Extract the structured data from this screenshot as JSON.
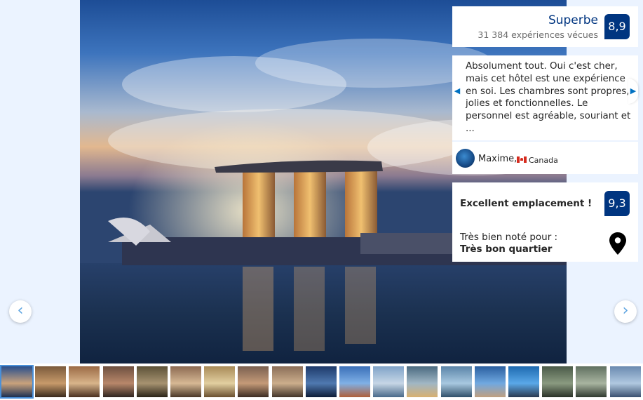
{
  "gallery": {
    "prev_label": "‹",
    "next_label": "›",
    "thumbnails": [
      {
        "name": "thumb-1",
        "colors": [
          "#2a4f8c",
          "#c9a27c",
          "#1b2f52"
        ],
        "selected": true
      },
      {
        "name": "thumb-2",
        "colors": [
          "#7a5a3c",
          "#c79a6a",
          "#3a2a1c"
        ],
        "selected": false
      },
      {
        "name": "thumb-3",
        "colors": [
          "#9b6a45",
          "#d8b48a",
          "#4a3020"
        ],
        "selected": false
      },
      {
        "name": "thumb-4",
        "colors": [
          "#6d5040",
          "#b8876a",
          "#2f2520"
        ],
        "selected": false
      },
      {
        "name": "thumb-5",
        "colors": [
          "#5c5238",
          "#a69270",
          "#2a2418"
        ],
        "selected": false
      },
      {
        "name": "thumb-6",
        "colors": [
          "#8c6a52",
          "#d6b894",
          "#4a3828"
        ],
        "selected": false
      },
      {
        "name": "thumb-7",
        "colors": [
          "#a88a58",
          "#e2cfa0",
          "#6a5030"
        ],
        "selected": false
      },
      {
        "name": "thumb-8",
        "colors": [
          "#7a6050",
          "#c49a78",
          "#3c2c22"
        ],
        "selected": false
      },
      {
        "name": "thumb-9",
        "colors": [
          "#8a6e58",
          "#ccae8c",
          "#42342a"
        ],
        "selected": false
      },
      {
        "name": "thumb-10",
        "colors": [
          "#1e3a6a",
          "#4f79b0",
          "#0e1d38"
        ],
        "selected": false
      },
      {
        "name": "thumb-11",
        "colors": [
          "#3a6fb8",
          "#7fb0e6",
          "#b0603a"
        ],
        "selected": false
      },
      {
        "name": "thumb-12",
        "colors": [
          "#7fa3c8",
          "#c6d6e6",
          "#4a6a8a"
        ],
        "selected": false
      },
      {
        "name": "thumb-13",
        "colors": [
          "#4a6a80",
          "#a0b6c4",
          "#d8b070"
        ],
        "selected": false
      },
      {
        "name": "thumb-14",
        "colors": [
          "#5a84a8",
          "#a8c8e0",
          "#30506a"
        ],
        "selected": false
      },
      {
        "name": "thumb-15",
        "colors": [
          "#2a5fa0",
          "#70a8e0",
          "#c0a080"
        ],
        "selected": false
      },
      {
        "name": "thumb-16",
        "colors": [
          "#1e6ab0",
          "#5aa8e8",
          "#2a3a50"
        ],
        "selected": false
      },
      {
        "name": "thumb-17",
        "colors": [
          "#4a5a48",
          "#8a9a80",
          "#2a3228"
        ],
        "selected": false
      },
      {
        "name": "thumb-18",
        "colors": [
          "#607060",
          "#a8b4a0",
          "#303a30"
        ],
        "selected": false
      },
      {
        "name": "thumb-19",
        "colors": [
          "#6a8ab0",
          "#b0c8e0",
          "#3a5070"
        ],
        "selected": false
      }
    ]
  },
  "rating": {
    "label": "Superbe",
    "count": "31 384 expériences vécues",
    "score": "8,9"
  },
  "review": {
    "text": "Absolument tout. Oui c'est cher, mais cet hôtel est une expérience en soi. Les chambres sont propres, jolies et fonctionnelles. Le personnel est agréable, souriant et ...",
    "reviewer": "Maxime,",
    "country": "Canada",
    "prev_arrow": "◀",
    "next_arrow": "▶"
  },
  "location": {
    "title": "Excellent emplacement !",
    "score": "9,3",
    "subtitle": "Très bien noté pour :",
    "feature": "Très bon quartier"
  },
  "colors": {
    "brand": "#003580",
    "accent": "#0071c2",
    "background": "#ebf3ff"
  }
}
